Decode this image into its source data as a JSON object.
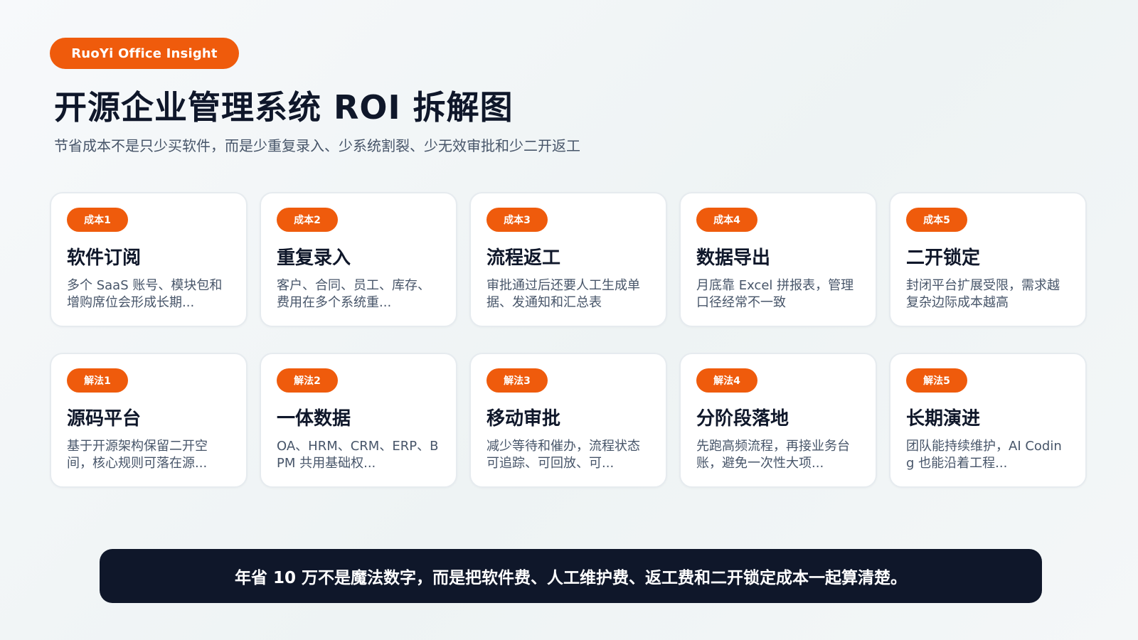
{
  "header": {
    "badge": "RuoYi Office Insight",
    "title": "开源企业管理系统 ROI 拆解图",
    "subtitle": "节省成本不是只少买软件，而是少重复录入、少系统割裂、少无效审批和少二开返工"
  },
  "costs": [
    {
      "tag": "成本1",
      "title": "软件订阅",
      "desc": "多个 SaaS 账号、模块包和增购席位会形成长期..."
    },
    {
      "tag": "成本2",
      "title": "重复录入",
      "desc": "客户、合同、员工、库存、费用在多个系统重..."
    },
    {
      "tag": "成本3",
      "title": "流程返工",
      "desc": "审批通过后还要人工生成单据、发通知和汇总表"
    },
    {
      "tag": "成本4",
      "title": "数据导出",
      "desc": "月底靠 Excel 拼报表，管理口径经常不一致"
    },
    {
      "tag": "成本5",
      "title": "二开锁定",
      "desc": "封闭平台扩展受限，需求越复杂边际成本越高"
    }
  ],
  "solutions": [
    {
      "tag": "解法1",
      "title": "源码平台",
      "desc": "基于开源架构保留二开空间，核心规则可落在源..."
    },
    {
      "tag": "解法2",
      "title": "一体数据",
      "desc": "OA、HRM、CRM、ERP、BPM 共用基础权..."
    },
    {
      "tag": "解法3",
      "title": "移动审批",
      "desc": "减少等待和催办，流程状态可追踪、可回放、可..."
    },
    {
      "tag": "解法4",
      "title": "分阶段落地",
      "desc": "先跑高频流程，再接业务台账，避免一次性大项..."
    },
    {
      "tag": "解法5",
      "title": "长期演进",
      "desc": "团队能持续维护，AI Coding 也能沿着工程..."
    }
  ],
  "footer": {
    "text": "年省 10 万不是魔法数字，而是把软件费、人工维护费、返工费和二开锁定成本一起算清楚。"
  },
  "colors": {
    "accent": "#ef5b0c",
    "dark": "#0f172a",
    "card_border": "#e6ebef",
    "muted_text": "#475569"
  }
}
